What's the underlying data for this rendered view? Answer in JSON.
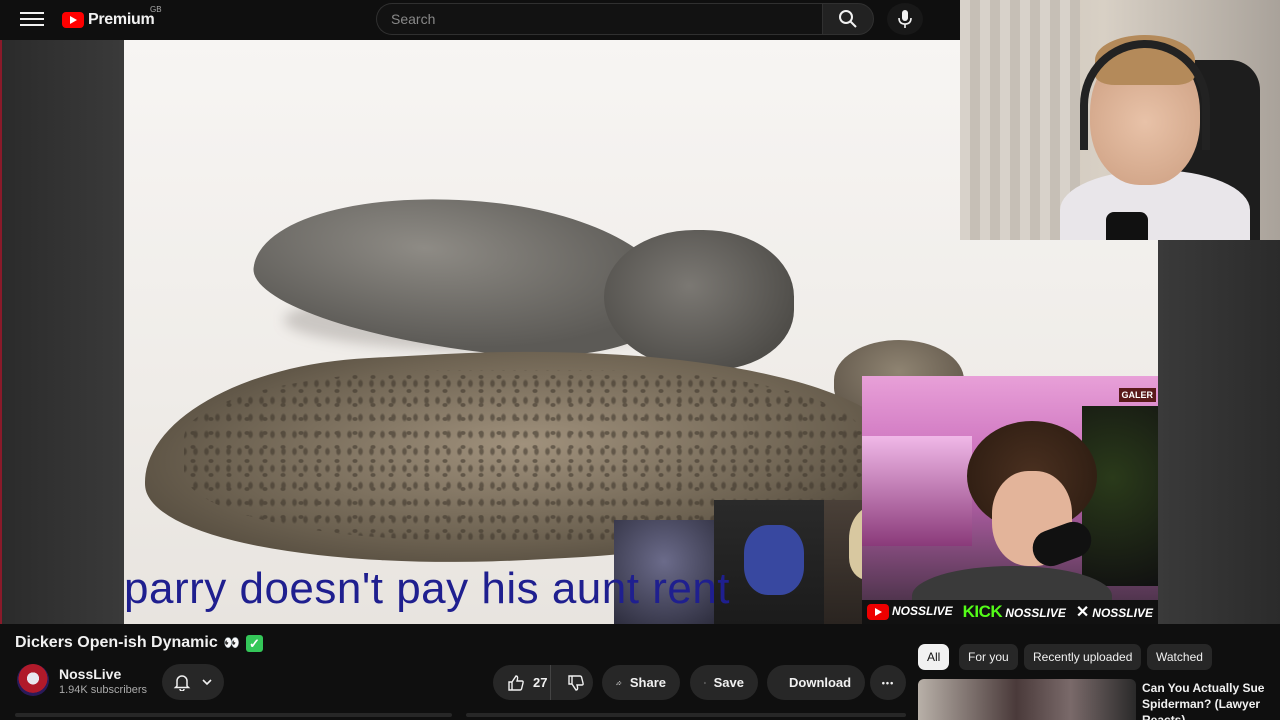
{
  "header": {
    "logo_text": "Premium",
    "logo_region": "GB",
    "search_placeholder": "Search"
  },
  "video": {
    "caption": "parry doesn't pay his aunt rent",
    "overlay_social": [
      {
        "platform": "youtube",
        "handle": "NOSSLIVE"
      },
      {
        "platform": "KICK",
        "handle": "NOSSLIVE"
      },
      {
        "platform": "x",
        "handle": "NOSSLIVE"
      }
    ],
    "overlay_sign": "GALER"
  },
  "meta": {
    "title": "Dickers Open-ish Dynamic",
    "title_emoji": "👀",
    "title_check": "✓",
    "channel_name": "NossLive",
    "subscribers": "1.94K subscribers"
  },
  "actions": {
    "likes": "27",
    "share": "Share",
    "save": "Save",
    "download": "Download",
    "more": "•••"
  },
  "chips": [
    "All",
    "For you",
    "Recently uploaded",
    "Watched"
  ],
  "recommendation": {
    "title": "Can You Actually Sue Spiderman? (Lawyer Reacts)"
  },
  "colors": {
    "background": "#0f0f0f",
    "brand_red": "#ff0000",
    "kick_green": "#53fc18",
    "caption_blue": "#1f1f8f",
    "check_green": "#34c759"
  }
}
